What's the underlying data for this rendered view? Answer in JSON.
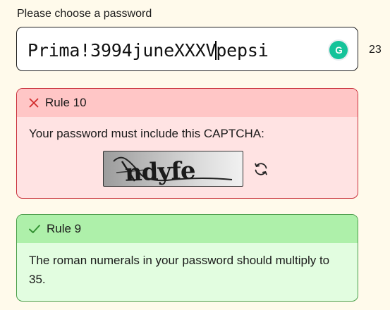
{
  "prompt": {
    "label": "Please choose a password"
  },
  "password": {
    "before_caret": "Prima!3994juneXXXV",
    "after_caret": "pepsi",
    "char_count": "23"
  },
  "grammarly": {
    "letter": "G",
    "color": "#15c39a"
  },
  "rules": [
    {
      "status": "failed",
      "title": "Rule 10",
      "description": "Your password must include this CAPTCHA:",
      "captcha_text": "ndyfe",
      "icon": "x-icon",
      "colors": {
        "border": "#c9313c",
        "header": "#ffc6c6",
        "body": "#ffe3e3",
        "icon": "#d12b2b"
      }
    },
    {
      "status": "passed",
      "title": "Rule 9",
      "description": "The roman numerals in your password should multiply to 35.",
      "icon": "check-icon",
      "colors": {
        "border": "#4a9e4a",
        "header": "#aef0aa",
        "body": "#e2fde0",
        "icon": "#2f8f2f"
      }
    }
  ]
}
